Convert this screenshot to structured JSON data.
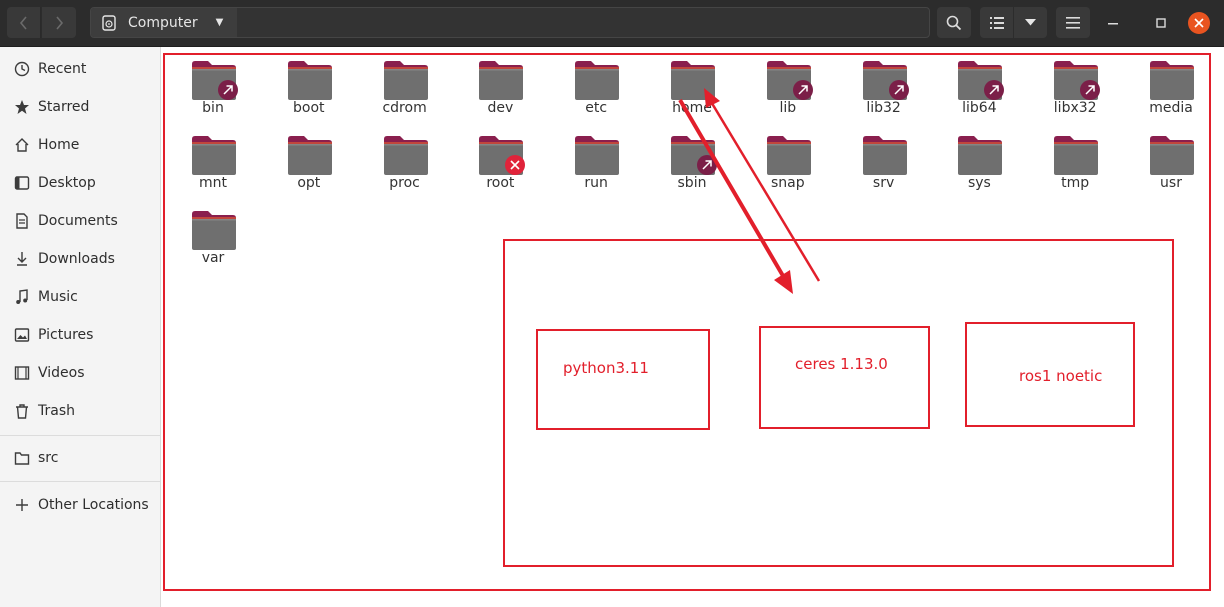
{
  "window": {
    "location": "Computer",
    "colors": {
      "header": "#2c2c2c",
      "accent": "#e95420",
      "annotation": "#e21f2b",
      "folder_body": "#6f6f6f",
      "folder_tab": "#8a1f4e"
    }
  },
  "header": {
    "back_icon": "chevron-left-icon",
    "forward_icon": "chevron-right-icon",
    "search_icon": "search-icon",
    "view_icon": "list-view-icon",
    "menu_icon": "hamburger-menu-icon"
  },
  "sidebar": {
    "items": [
      {
        "label": "Recent",
        "icon": "clock-icon"
      },
      {
        "label": "Starred",
        "icon": "star-icon"
      },
      {
        "label": "Home",
        "icon": "home-icon"
      },
      {
        "label": "Desktop",
        "icon": "desktop-icon"
      },
      {
        "label": "Documents",
        "icon": "document-icon"
      },
      {
        "label": "Downloads",
        "icon": "download-icon"
      },
      {
        "label": "Music",
        "icon": "music-icon"
      },
      {
        "label": "Pictures",
        "icon": "picture-icon"
      },
      {
        "label": "Videos",
        "icon": "video-icon"
      },
      {
        "label": "Trash",
        "icon": "trash-icon"
      }
    ],
    "bookmarks": [
      {
        "label": "src",
        "icon": "folder-icon"
      }
    ],
    "other": {
      "label": "Other Locations",
      "icon": "plus-icon"
    }
  },
  "files": [
    {
      "name": "bin",
      "emblem": "symlink"
    },
    {
      "name": "boot",
      "emblem": ""
    },
    {
      "name": "cdrom",
      "emblem": ""
    },
    {
      "name": "dev",
      "emblem": ""
    },
    {
      "name": "etc",
      "emblem": ""
    },
    {
      "name": "home",
      "emblem": ""
    },
    {
      "name": "lib",
      "emblem": "symlink"
    },
    {
      "name": "lib32",
      "emblem": "symlink"
    },
    {
      "name": "lib64",
      "emblem": "symlink"
    },
    {
      "name": "libx32",
      "emblem": "symlink"
    },
    {
      "name": "media",
      "emblem": ""
    },
    {
      "name": "mnt",
      "emblem": ""
    },
    {
      "name": "opt",
      "emblem": ""
    },
    {
      "name": "proc",
      "emblem": ""
    },
    {
      "name": "root",
      "emblem": "no-access"
    },
    {
      "name": "run",
      "emblem": ""
    },
    {
      "name": "sbin",
      "emblem": "symlink"
    },
    {
      "name": "snap",
      "emblem": ""
    },
    {
      "name": "srv",
      "emblem": ""
    },
    {
      "name": "sys",
      "emblem": ""
    },
    {
      "name": "tmp",
      "emblem": ""
    },
    {
      "name": "usr",
      "emblem": ""
    },
    {
      "name": "var",
      "emblem": ""
    }
  ],
  "annotations": {
    "boxes": [
      {
        "text": "python3.11"
      },
      {
        "text": "ceres 1.13.0"
      },
      {
        "text": "ros1 noetic"
      }
    ]
  }
}
